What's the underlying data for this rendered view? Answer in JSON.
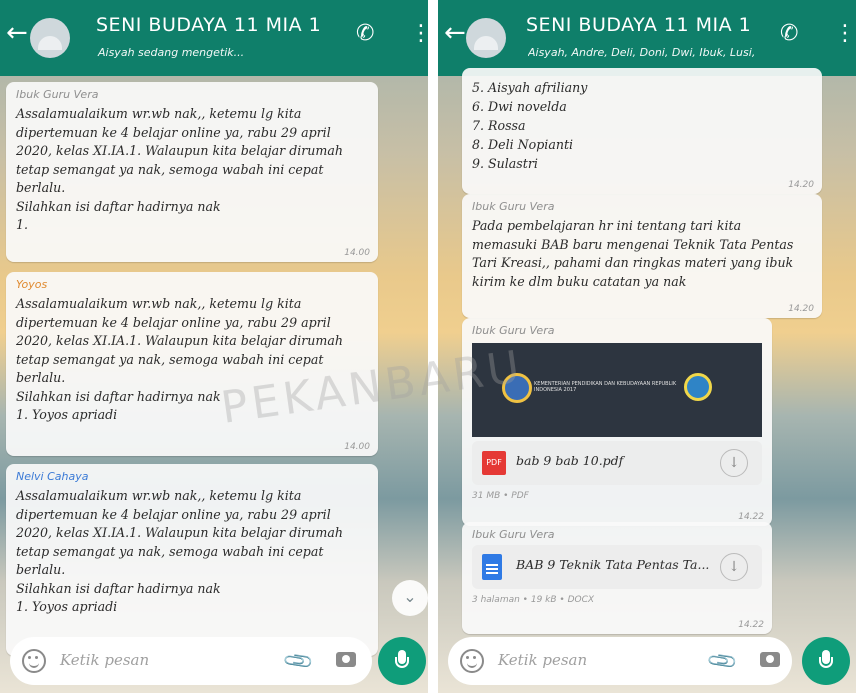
{
  "left": {
    "header": {
      "back_icon": "arrow-left-icon",
      "title": "SENI BUDAYA 11 MIA 1",
      "subtitle": "Aisyah sedang mengetik...",
      "call_icon": "add-call-icon",
      "menu_icon": "more-vertical-icon"
    },
    "messages": [
      {
        "sender": "Ibuk Guru Vera",
        "text": "Assalamualaikum wr.wb nak,, ketemu lg kita\ndipertemuan ke 4 belajar online ya, rabu 29 april\n2020, kelas XI.IA.1. Walaupun kita belajar dirumah\ntetap semangat ya nak, semoga wabah ini cepat\nberlalu.\nSilahkan isi daftar hadirnya nak\n1.",
        "time": "14.00"
      },
      {
        "sender": "Yoyos",
        "text": "Assalamualaikum wr.wb nak,, ketemu lg kita\ndipertemuan ke 4 belajar online ya, rabu 29 april\n2020, kelas XI.IA.1. Walaupun kita belajar dirumah\ntetap semangat ya nak, semoga wabah ini cepat\nberlalu.\nSilahkan isi daftar hadirnya nak\n1. Yoyos apriadi",
        "time": "14.00"
      },
      {
        "sender": "Nelvi Cahaya",
        "text": "Assalamualaikum wr.wb nak,, ketemu lg kita\ndipertemuan ke 4 belajar online ya, rabu 29 april\n2020, kelas XI.IA.1. Walaupun kita belajar dirumah\ntetap semangat ya nak, semoga wabah ini cepat\nberlalu.\nSilahkan isi daftar hadirnya nak\n1. Yoyos apriadi",
        "time": ""
      }
    ],
    "input_placeholder": "Ketik pesan"
  },
  "right": {
    "header": {
      "title": "SENI BUDAYA 11 MIA 1",
      "subtitle": "Aisyah, Andre, Deli, Doni, Dwi, Ibuk, Lusi,..."
    },
    "list_message": {
      "text": "5. Aisyah afriliany\n6. Dwi novelda\n7. Rossa\n8. Deli Nopianti\n9. Sulastri",
      "time": "14.20"
    },
    "text_message": {
      "sender": "Ibuk Guru Vera",
      "text": "Pada pembelajaran hr ini tentang tari kita\nmemasuki BAB baru mengenai Teknik Tata Pentas\nTari Kreasi,, pahami dan ringkas materi yang ibuk\nkirim ke dlm buku catatan ya nak",
      "time": "14.20"
    },
    "pdf_message": {
      "sender": "Ibuk Guru Vera",
      "preview_text": "KEMENTERIAN PENDIDIKAN DAN KEBUDAYAAN REPUBLIK INDONESIA 2017",
      "file_type_label": "PDF",
      "file_name": "bab 9 bab 10.pdf",
      "meta": "31 MB • PDF",
      "time": "14.22"
    },
    "docx_message": {
      "sender": "Ibuk Guru Vera",
      "file_name": "BAB 9 Teknik Tata Pentas Ta...",
      "meta": "3 halaman • 19 kB • DOCX",
      "time": "14.22"
    },
    "input_placeholder": "Ketik pesan"
  },
  "watermark": "PEKANBARU",
  "colors": {
    "header": "#0f7f6a",
    "mic": "#0f9d7a",
    "sender_orange": "#e08a30",
    "sender_blue": "#3b7ad6"
  }
}
